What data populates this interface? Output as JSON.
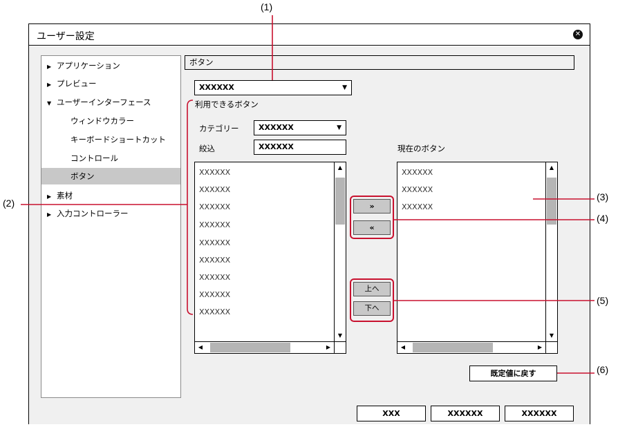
{
  "callouts": {
    "c1": "(1)",
    "c2": "(2)",
    "c3": "(3)",
    "c4": "(4)",
    "c5": "(5)",
    "c6": "(6)"
  },
  "dialog": {
    "title": "ユーザー設定",
    "close_icon": "close-icon"
  },
  "tree": {
    "items": [
      {
        "label": "アプリケーション",
        "expanded": false
      },
      {
        "label": "プレビュー",
        "expanded": false
      },
      {
        "label": "ユーザーインターフェース",
        "expanded": true
      },
      {
        "label": "ウィンドウカラー"
      },
      {
        "label": "キーボードショートカット"
      },
      {
        "label": "コントロール"
      },
      {
        "label": "ボタン",
        "selected": true
      },
      {
        "label": "素材",
        "expanded": false
      },
      {
        "label": "入力コントローラー",
        "expanded": false
      }
    ]
  },
  "panel": {
    "header": "ボタン",
    "target_dropdown": "XXXXXX",
    "available_group_label": "利用できるボタン",
    "category_label": "カテゴリー",
    "category_value": "XXXXXX",
    "filter_label": "絞込",
    "filter_value": "XXXXXX",
    "current_label": "現在のボタン",
    "available_items": [
      "XXXXXX",
      "XXXXXX",
      "XXXXXX",
      "XXXXXX",
      "XXXXXX",
      "XXXXXX",
      "XXXXXX",
      "XXXXXX",
      "XXXXXX"
    ],
    "current_items": [
      "XXXXXX",
      "XXXXXX",
      "XXXXXX"
    ],
    "add_button": "»",
    "remove_button": "«",
    "up_button": "上へ",
    "down_button": "下へ",
    "reset_button": "既定値に戻す"
  },
  "footer": {
    "btn1": "XXX",
    "btn2": "XXXXXX",
    "btn3": "XXXXXX"
  },
  "colors": {
    "callout_red": "#c8102e",
    "selected_row": "#c8c8c8",
    "panel_bg": "#f0f0f0"
  }
}
